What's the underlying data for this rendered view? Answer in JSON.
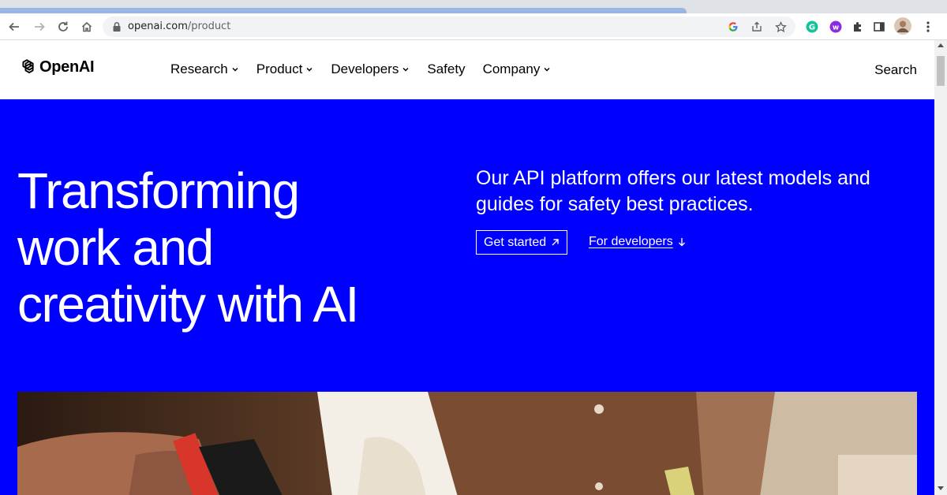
{
  "browser": {
    "url_domain": "openai.com",
    "url_path": "/product",
    "icons": [
      "back-arrow-icon",
      "forward-arrow-icon",
      "reload-icon",
      "home-icon",
      "lock-icon",
      "google-icon",
      "share-icon",
      "star-icon",
      "grammarly-icon",
      "extension-w-icon",
      "puzzle-icon",
      "sidebar-icon",
      "profile-avatar",
      "more-menu-icon"
    ]
  },
  "site": {
    "logo_text": "OpenAI",
    "nav": [
      {
        "label": "Research",
        "has_dropdown": true
      },
      {
        "label": "Product",
        "has_dropdown": true
      },
      {
        "label": "Developers",
        "has_dropdown": true
      },
      {
        "label": "Safety",
        "has_dropdown": false
      },
      {
        "label": "Company",
        "has_dropdown": true
      }
    ],
    "search_label": "Search"
  },
  "hero": {
    "title_line1": "Transforming",
    "title_line2": "work and",
    "title_line3": "creativity with AI",
    "subtitle": "Our API platform offers our latest models and guides for safety best practices.",
    "cta_primary": "Get started",
    "cta_secondary": "For developers",
    "background_color": "#0000ff"
  }
}
